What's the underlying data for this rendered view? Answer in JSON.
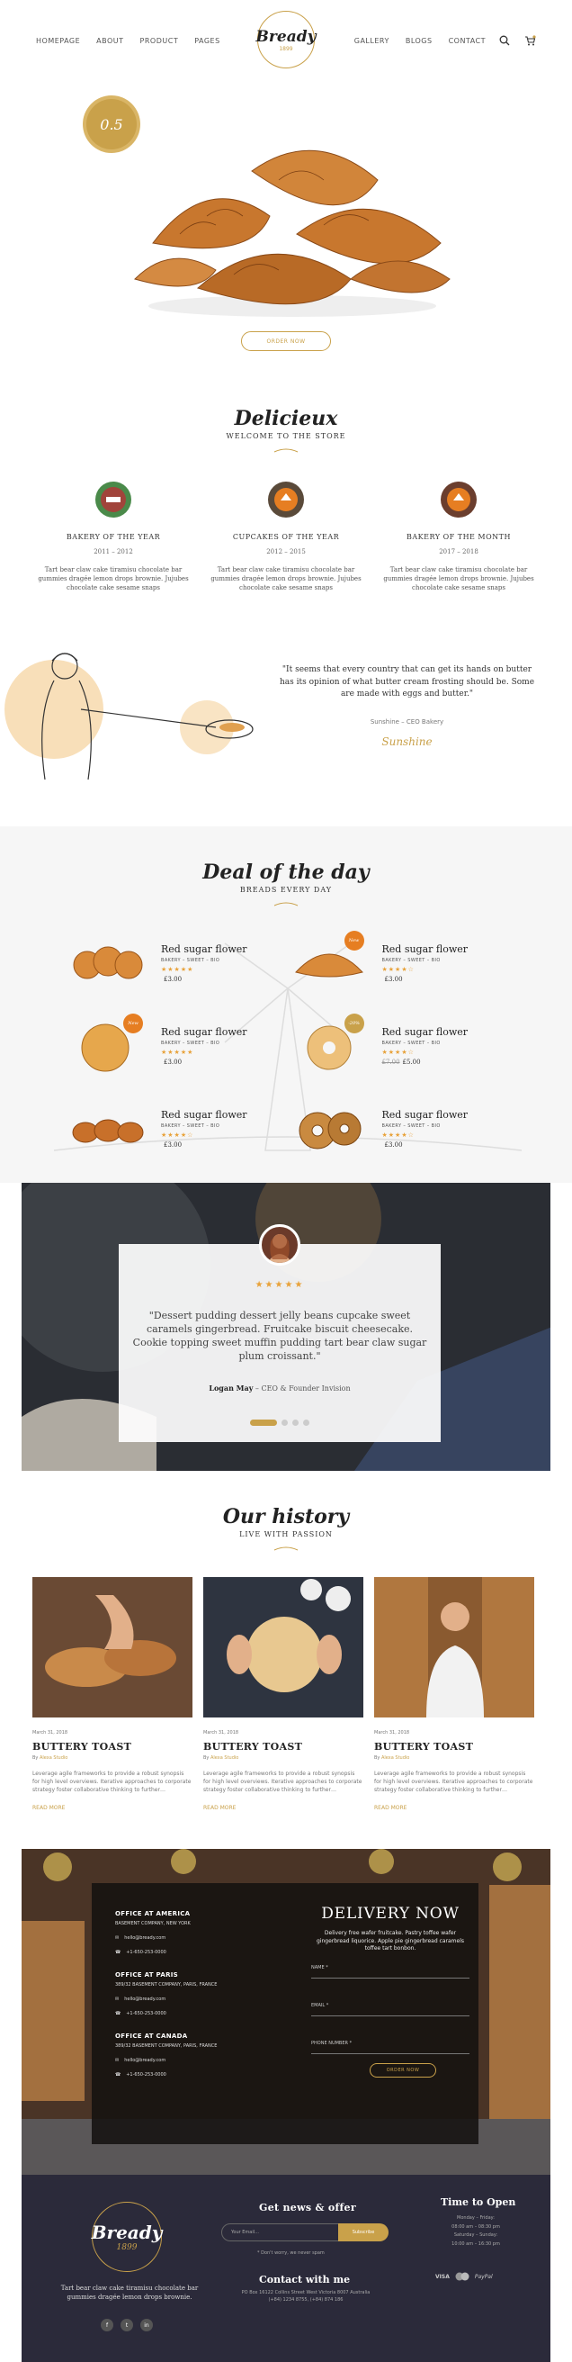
{
  "nav": {
    "left": [
      "HOMEPAGE",
      "ABOUT",
      "PRODUCT",
      "PAGES"
    ],
    "right": [
      "GALLERY",
      "BLOGS",
      "CONTACT"
    ]
  },
  "logo": {
    "name": "Bready",
    "year": "1899"
  },
  "hero": {
    "badge": "0.5",
    "button": "ORDER NOW"
  },
  "welcome": {
    "title": "Delicieux",
    "subtitle": "WELCOME TO THE STORE",
    "features": [
      {
        "title": "BAKERY OF THE YEAR",
        "years": "2011 – 2012",
        "desc": "Tart bear claw cake tiramisu chocolate bar gummies dragée lemon drops brownie. Jujubes chocolate cake sesame snaps",
        "color": "#a1443b"
      },
      {
        "title": "CUPCAKES OF THE YEAR",
        "years": "2012 – 2015",
        "desc": "Tart bear claw cake tiramisu chocolate bar gummies dragée lemon drops brownie. Jujubes chocolate cake sesame snaps",
        "color": "#5a4a3a"
      },
      {
        "title": "BAKERY OF THE MONTH",
        "years": "2017 – 2018",
        "desc": "Tart bear claw cake tiramisu chocolate bar gummies dragée lemon drops brownie. Jujubes chocolate cake sesame snaps",
        "color": "#6b3e2e"
      }
    ]
  },
  "quote": {
    "text": "\"It seems that every country that can get its hands on butter has its opinion of what butter cream frosting should be. Some are made with eggs and butter.\"",
    "author": "Sunshine – CEO Bakery",
    "signature": "Sunshine"
  },
  "deals": {
    "title": "Deal of the day",
    "subtitle": "BREADS EVERY DAY",
    "items": [
      {
        "name": "Red sugar flower",
        "cats": "BAKERY – SWEET – BIO",
        "stars": "★★★★★",
        "old": "",
        "price": "£3.00",
        "tag": ""
      },
      {
        "name": "Red sugar flower",
        "cats": "BAKERY – SWEET – BIO",
        "stars": "★★★★☆",
        "old": "",
        "price": "£3.00",
        "tag": "New"
      },
      {
        "name": "Red sugar flower",
        "cats": "BAKERY – SWEET – BIO",
        "stars": "★★★★★",
        "old": "",
        "price": "£3.00",
        "tag": "New"
      },
      {
        "name": "Red sugar flower",
        "cats": "BAKERY – SWEET – BIO",
        "stars": "★★★★☆",
        "old": "£7.00",
        "price": "£5.00",
        "tag": "-20%"
      },
      {
        "name": "Red sugar flower",
        "cats": "BAKERY – SWEET – BIO",
        "stars": "★★★★☆",
        "old": "",
        "price": "£3.00",
        "tag": ""
      },
      {
        "name": "Red sugar flower",
        "cats": "BAKERY – SWEET – BIO",
        "stars": "★★★★☆",
        "old": "",
        "price": "£3.00",
        "tag": ""
      }
    ]
  },
  "testimonial": {
    "stars": "★★★★★",
    "text": "\"Dessert pudding dessert jelly beans cupcake sweet caramels gingerbread. Fruitcake biscuit cheesecake. Cookie topping sweet muffin pudding tart bear claw sugar plum croissant.\"",
    "name": "Logan May",
    "role": " – CEO & Founder Invision"
  },
  "history": {
    "title": "Our history",
    "subtitle": "LIVE WITH PASSION",
    "posts": [
      {
        "date": "March 31, 2018",
        "title": "BUTTERY TOAST",
        "by": "By ",
        "author": "Alexa Studio",
        "excerpt": "Leverage agile frameworks to provide a robust synopsis for high level overviews. Iterative approaches to corporate strategy foster collaborative thinking to further…",
        "more": "READ MORE"
      },
      {
        "date": "March 31, 2018",
        "title": "BUTTERY TOAST",
        "by": "By ",
        "author": "Alexa Studio",
        "excerpt": "Leverage agile frameworks to provide a robust synopsis for high level overviews. Iterative approaches to corporate strategy foster collaborative thinking to further…",
        "more": "READ MORE"
      },
      {
        "date": "March 31, 2018",
        "title": "BUTTERY TOAST",
        "by": "By ",
        "author": "Alexa Studio",
        "excerpt": "Leverage agile frameworks to provide a robust synopsis for high level overviews. Iterative approaches to corporate strategy foster collaborative thinking to further…",
        "more": "READ MORE"
      }
    ]
  },
  "offices": [
    {
      "name": "OFFICE AT AMERICA",
      "addr": "BASEMENT COMPANY, NEW YORK",
      "email": "hello@bready.com",
      "phone": "+1-650-253-0000"
    },
    {
      "name": "OFFICE AT PARIS",
      "addr": "389/32 BASEMENT COMPANY, PARIS, FRANCE",
      "email": "hello@bready.com",
      "phone": "+1-650-253-0000"
    },
    {
      "name": "OFFICE AT CANADA",
      "addr": "389/32 BASEMENT COMPANY, PARIS, FRANCE",
      "email": "hello@bready.com",
      "phone": "+1-650-253-0000"
    }
  ],
  "delivery": {
    "title": "DELIVERY NOW",
    "desc": "Delivery free wafer fruitcake. Pastry toffee wafer gingerbread liquorice. Apple pie gingerbread caramels toffee tart bonbon.",
    "name_ph": "NAME *",
    "email_ph": "EMAIL *",
    "phone_ph": "PHONE NUMBER *",
    "button": "ORDER NOW"
  },
  "footer": {
    "desc": "Tart bear claw cake tiramisu chocolate bar gummies dragée lemon drops brownie.",
    "social": [
      "f",
      "t",
      "in"
    ],
    "news_title": "Get news & offer",
    "email_ph": "Your Email...",
    "subscribe": "Subscribe",
    "news_note": "* Don't worry, we never spam",
    "contact_title": "Contact with me",
    "contact_addr": "PO Box 16122 Collins Street West Victoria 8007 Australia",
    "contact_phone": "(+84) 1234 8755, (+84) 874 186",
    "open_title": "Time to Open",
    "hours": [
      "Monday – Friday:",
      "08:00 am – 08:30 pm",
      "Saturday – Sunday:",
      "10:00 am – 16:30 pm"
    ],
    "payments": [
      "VISA",
      "PayPal"
    ]
  },
  "colors": {
    "accent": "#c9a14a",
    "dark": "#2b2a3a",
    "deal_bg": "#f6f6f6"
  }
}
